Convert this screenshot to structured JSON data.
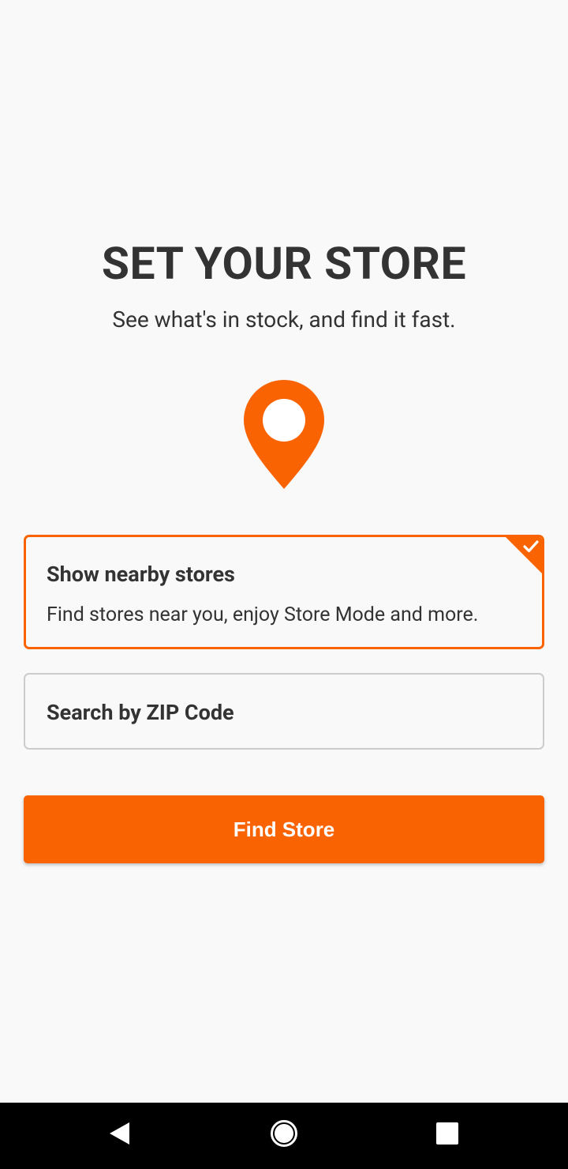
{
  "screen": {
    "title": "SET YOUR STORE",
    "subtitle": "See what's in stock, and find it fast."
  },
  "icons": {
    "pin": "location-pin-icon",
    "check": "checkmark-icon"
  },
  "options": [
    {
      "title": "Show nearby stores",
      "description": "Find stores near you, enjoy Store Mode and more.",
      "selected": true
    },
    {
      "title": "Search by ZIP Code",
      "selected": false
    }
  ],
  "find_button": {
    "label": "Find Store"
  },
  "colors": {
    "accent": "#f96302",
    "text": "#333333",
    "background": "#f9f9f9",
    "border": "#cccccc"
  }
}
